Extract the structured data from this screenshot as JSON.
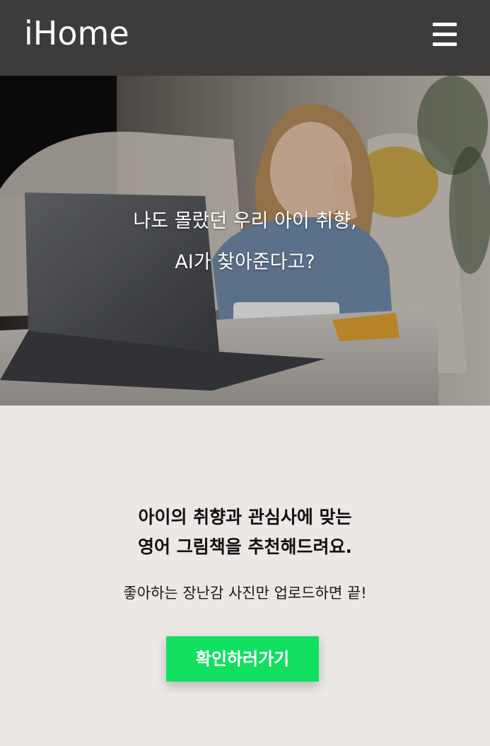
{
  "header": {
    "logo": "iHome",
    "menu_icon": "hamburger-menu-icon"
  },
  "hero": {
    "line1": "나도 몰랐던 우리 아이 취향,",
    "line2": "AI가 찾아준다고?"
  },
  "main": {
    "headline_line1": "아이의 취향과 관심사에 맞는",
    "headline_line2": "영어 그림책을 추천해드려요.",
    "subtext": "좋아하는 장난감 사진만 업로드하면 끝!",
    "cta_label": "확인하러가기"
  },
  "colors": {
    "header_bg": "#3d3c3b",
    "page_bg": "#ebe8e6",
    "cta_bg": "#12e060"
  }
}
